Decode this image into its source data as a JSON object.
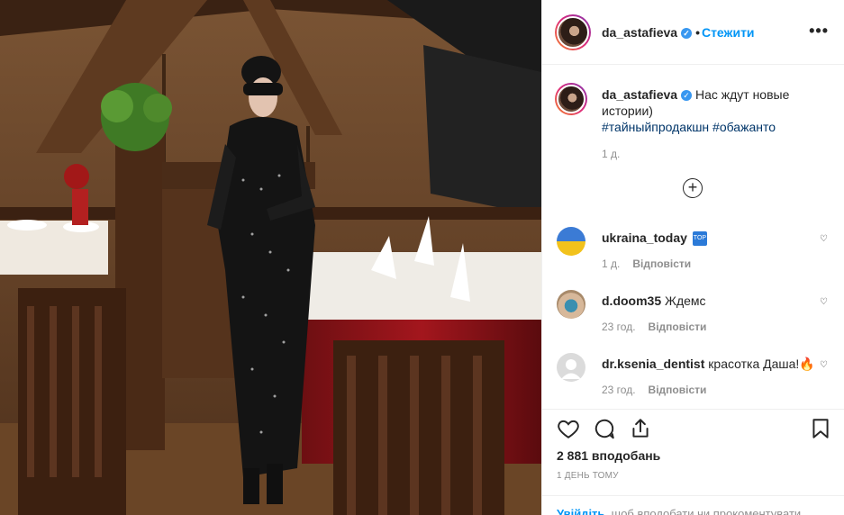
{
  "post": {
    "username": "da_astafieva",
    "follow_label": "Стежити",
    "more_label": "•••"
  },
  "caption": {
    "username": "da_astafieva",
    "text": "Нас ждут новые истории)",
    "hashtags": "#тайныйпродакшн #обажанто",
    "time": "1 д."
  },
  "load_more": "+",
  "comments": [
    {
      "username": "ukraina_today",
      "text": "",
      "badge": "TOP",
      "time": "1 д.",
      "reply": "Відповісти"
    },
    {
      "username": "d.doom35",
      "text": "Ждемс",
      "time": "23 год.",
      "reply": "Відповісти"
    },
    {
      "username": "dr.ksenia_dentist",
      "text": "красотка Даша!🔥",
      "time": "23 год.",
      "reply": "Відповісти"
    }
  ],
  "stats": {
    "likes": "2 881 вподобань",
    "posted": "1 ДЕНЬ ТОМУ"
  },
  "login_hint": {
    "link": "Увійдіть",
    "text": ", щоб вподобати чи прокоментувати"
  },
  "icons": [
    "verified-icon",
    "more-options-icon",
    "load-more-icon",
    "heart-icon",
    "comment-icon",
    "share-icon",
    "bookmark-icon",
    "top-badge-icon"
  ],
  "colors": {
    "link": "#0095f6",
    "hashtag": "#003569",
    "muted": "#8e8e8e",
    "text": "#262626"
  }
}
